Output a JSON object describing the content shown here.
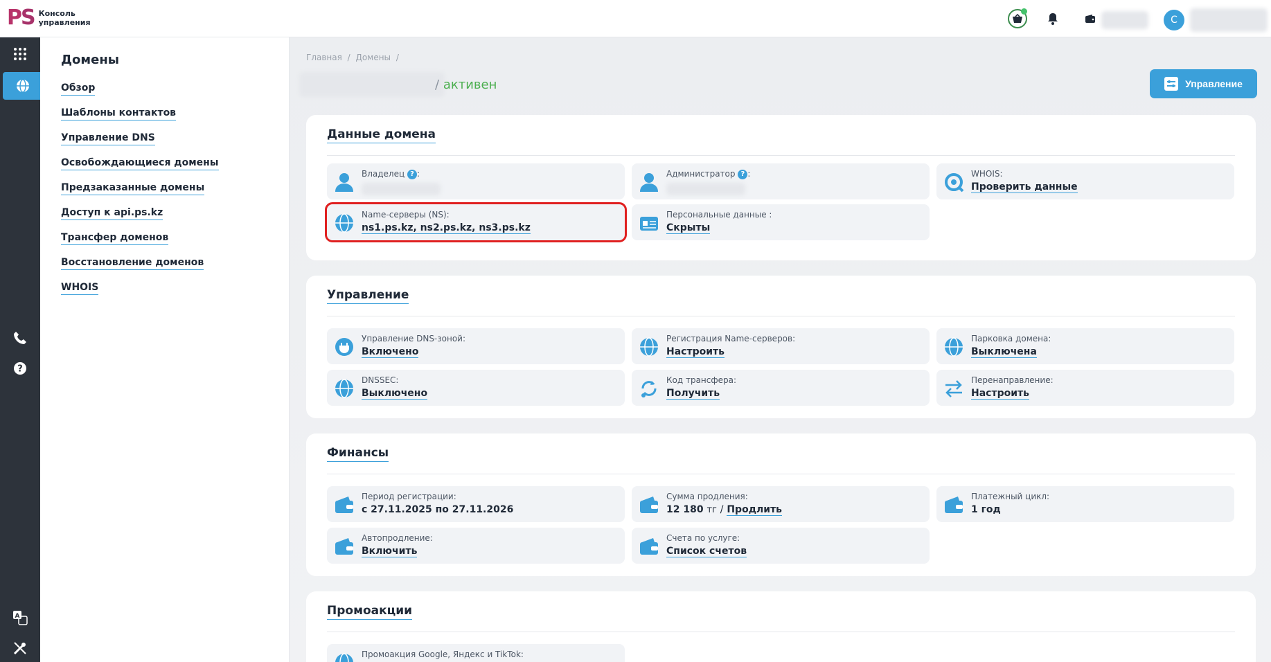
{
  "app": {
    "logo_mark_p": "P",
    "logo_mark_s": "S",
    "logo_line1": "Консоль",
    "logo_line2": "управления",
    "avatar_letter": "С"
  },
  "icons": {
    "rail": [
      "grid-icon",
      "globe-icon",
      "phone-icon",
      "help-icon",
      "translate-icon",
      "tools-icon"
    ],
    "top": [
      "cart-icon",
      "bell-icon",
      "wallet-icon"
    ]
  },
  "colors": {
    "accent": "#3ba0da",
    "status_active": "#4caf50",
    "highlight": "#e02020",
    "rail_bg": "#2d333b"
  },
  "sidebar": {
    "title": "Домены",
    "items": [
      "Обзор",
      "Шаблоны контактов",
      "Управление DNS",
      "Освобождающиеся домены",
      "Предзаказанные домены",
      "Доступ к api.ps.kz",
      "Трансфер доменов",
      "Восстановление доменов",
      "WHOIS"
    ]
  },
  "breadcrumb": {
    "home": "Главная",
    "sep": "/",
    "domains": "Домены",
    "sep2": "/"
  },
  "header": {
    "status_sep": "/",
    "status": "активен",
    "manage_button": "Управление"
  },
  "domain_data": {
    "title": "Данные домена",
    "owner_label": "Владелец",
    "admin_label": "Администратор",
    "help": "?",
    "colon": ":",
    "whois_label": "WHOIS:",
    "whois_value": "Проверить данные",
    "ns_label": "Name-серверы (NS):",
    "ns_value": "ns1.ps.kz, ns2.ps.kz, ns3.ps.kz",
    "personal_label": "Персональные данные :",
    "personal_value": "Скрыты"
  },
  "management": {
    "title": "Управление",
    "dns_zone_label": "Управление DNS-зоной:",
    "dns_zone_value": "Включено",
    "ns_reg_label": "Регистрация Name-серверов:",
    "ns_reg_value": "Настроить",
    "parking_label": "Парковка домена:",
    "parking_value": "Выключена",
    "dnssec_label": "DNSSEC:",
    "dnssec_value": "Выключено",
    "transfer_label": "Код трансфера:",
    "transfer_value": "Получить",
    "redirect_label": "Перенаправление:",
    "redirect_value": "Настроить"
  },
  "finance": {
    "title": "Финансы",
    "period_label": "Период регистрации:",
    "period_value": "с 27.11.2025 по 27.11.2026",
    "renew_label": "Сумма продления:",
    "renew_amount": "12 180",
    "renew_currency": "тг",
    "renew_sep": "/",
    "renew_link": "Продлить",
    "cycle_label": "Платежный цикл:",
    "cycle_value": "1 год",
    "autorenew_label": "Автопродление:",
    "autorenew_value": "Включить",
    "invoices_label": "Счета по услуге:",
    "invoices_value": "Список счетов"
  },
  "promo": {
    "title": "Промоакции",
    "item_label": "Промоакция Google, Яндекс и TikTok:"
  }
}
